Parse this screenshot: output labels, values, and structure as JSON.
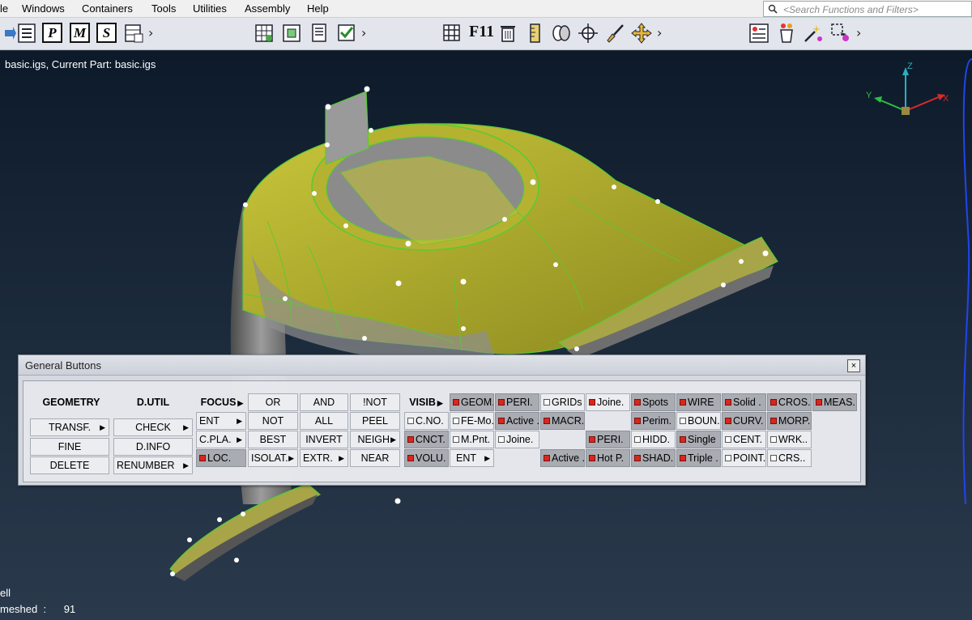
{
  "menu": [
    "le",
    "Windows",
    "Containers",
    "Tools",
    "Utilities",
    "Assembly",
    "Help"
  ],
  "search": {
    "placeholder": "<Search Functions and Filters>"
  },
  "toolbar": {
    "p_label": "P",
    "m_label": "M",
    "s_label": "S",
    "f11_label": "F11",
    "more": "›"
  },
  "viewport": {
    "part_info": "basic.igs,   Current Part: basic.igs",
    "axes": {
      "z": "Z",
      "y": "Y",
      "x": "X"
    },
    "bottom_line1": "ell",
    "bottom_line2": "meshed  :      91"
  },
  "panel": {
    "title": "General Buttons",
    "close": "×",
    "geometry": {
      "header": "GEOMETRY",
      "transf": "TRANSF.",
      "fine": "FINE",
      "delete": "DELETE"
    },
    "dutil": {
      "header": "D.UTIL",
      "check": "CHECK",
      "dinfo": "D.INFO",
      "renumber": "RENUMBER"
    },
    "focus": {
      "header": "FOCUS",
      "ent": "ENT",
      "cpla": "C.PLA.",
      "loc": "LOC.",
      "or": "OR",
      "and": "AND",
      "not_bang": "!NOT",
      "not": "NOT",
      "all": "ALL",
      "peel": "PEEL",
      "best": "BEST",
      "invert": "INVERT",
      "neigh": "NEIGH.",
      "isolat": "ISOLAT.",
      "extr": "EXTR.",
      "near": "NEAR"
    },
    "visib": {
      "header": "VISIB",
      "row1": [
        "GEOM.",
        "PERI.",
        "GRIDs",
        "Joine.",
        "Spots",
        "WIRE",
        "Solid .",
        "CROS.",
        "MEAS."
      ],
      "row2": [
        "C.NO.",
        "FE-Mo.",
        "Active .",
        "MACR.",
        "Perim.",
        "BOUN.",
        "CURV.",
        "MORP."
      ],
      "row3": [
        "CNCT.",
        "M.Pnt.",
        "Joine.",
        "PERI.",
        "HIDD.",
        "Single",
        "CENT.",
        "WRK.."
      ],
      "row4": [
        "VOLU.",
        "ENT",
        "Active .",
        "Hot P.",
        "SHAD.",
        "Triple .",
        "POINT.",
        "CRS.."
      ]
    }
  },
  "colors": {
    "model_yellow": "#b8b52e",
    "model_gray": "#8c8c8c",
    "mesh_green": "#44dd33",
    "checkbox_on": "#d9271e"
  }
}
